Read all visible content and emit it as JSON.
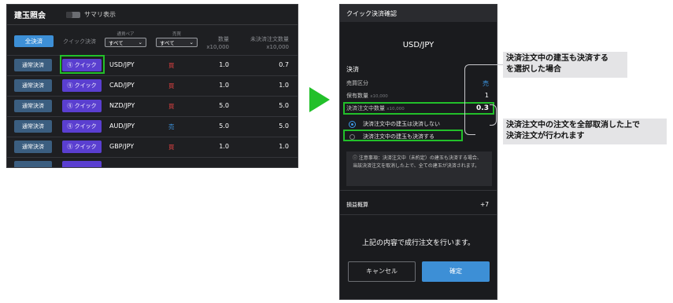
{
  "left_panel": {
    "title": "建玉照会",
    "summary_toggle_label": "サマリ表示",
    "all_settle_label": "全決済",
    "quick_settle_header": "クイック決済",
    "currency_pair_filter": {
      "label": "通貨ペア",
      "value": "すべて"
    },
    "side_filter": {
      "label": "売買",
      "value": "すべて"
    },
    "qty_header": {
      "line1": "数量",
      "line2": "x10,000"
    },
    "open_qty_header": {
      "line1": "未決済注文数量",
      "line2": "x10,000"
    },
    "rows": [
      {
        "normal_label": "通常決済",
        "quick_label": "ⓠ クイック",
        "pair": "USD/JPY",
        "side": "買",
        "qty": "1.0",
        "open_qty": "0.7"
      },
      {
        "normal_label": "通常決済",
        "quick_label": "ⓠ クイック",
        "pair": "CAD/JPY",
        "side": "買",
        "qty": "1.0",
        "open_qty": "1.0"
      },
      {
        "normal_label": "通常決済",
        "quick_label": "ⓠ クイック",
        "pair": "NZD/JPY",
        "side": "買",
        "qty": "5.0",
        "open_qty": "5.0"
      },
      {
        "normal_label": "通常決済",
        "quick_label": "ⓠ クイック",
        "pair": "AUD/JPY",
        "side": "売",
        "qty": "5.0",
        "open_qty": "5.0"
      },
      {
        "normal_label": "通常決済",
        "quick_label": "ⓠ クイック",
        "pair": "GBP/JPY",
        "side": "買",
        "qty": "1.0",
        "open_qty": "1.0"
      }
    ]
  },
  "dialog": {
    "title": "クイック決済確認",
    "pair": "USD/JPY",
    "section_label": "決済",
    "side_label": "売買区分",
    "side_value": "売",
    "held_qty_label": "保有数量",
    "held_qty_unit": "x10,000",
    "held_qty_value": "1",
    "order_qty_label": "決済注文中数量",
    "order_qty_unit": "x10,000",
    "order_qty_value": "0.3",
    "radio_option_1": "決済注文中の建玉は決済しない",
    "radio_option_2": "決済注文中の建玉も決済する",
    "notice": "ⓘ 注意事項：決済注文中（未約定）の建玉も決済する場合、当該決済注文を取消した上で、全ての建玉が決済されます。",
    "pl_label": "損益概算",
    "pl_value": "+7",
    "confirm_text": "上記の内容で成行注文を行います。",
    "cancel_label": "キャンセル",
    "ok_label": "確定"
  },
  "annotations": {
    "note1": "決済注文中の建玉も決済する\nを選択した場合",
    "note2": "決済注文中の注文を全部取消した上で\n決済注文が行われます"
  },
  "colors": {
    "highlight": "#22c02a",
    "buy_red": "#e04141",
    "sell_blue": "#3d9ae8",
    "accent": "#3d8fd6",
    "quick_button": "#5a3fd0"
  }
}
